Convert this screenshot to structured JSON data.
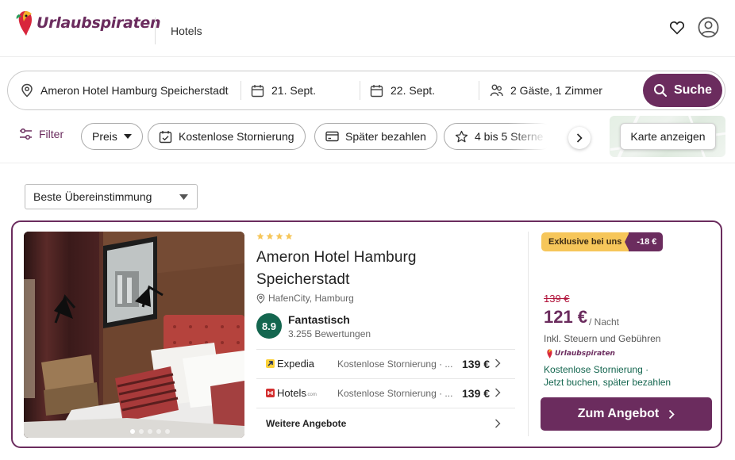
{
  "header": {
    "brand": "Urlaubspiraten",
    "section": "Hotels"
  },
  "search": {
    "destination": "Ameron Hotel Hamburg Speicherstadt",
    "checkin": "21. Sept.",
    "checkout": "22. Sept.",
    "guests": "2 Gäste, 1 Zimmer",
    "button_label": "Suche"
  },
  "filters": {
    "filter_label": "Filter",
    "chips": [
      "Preis",
      "Kostenlose Stornierung",
      "Später bezahlen",
      "4 bis 5 Sterne"
    ],
    "map_button": "Karte anzeigen"
  },
  "sort": {
    "selected": "Beste Übereinstimmung"
  },
  "hotel": {
    "stars": 4,
    "name": "Ameron Hotel Hamburg Speicherstadt",
    "location": "HafenCity, Hamburg",
    "rating": "8.9",
    "rating_label": "Fantastisch",
    "review_count": "3.255 Bewertungen",
    "photo_count": 5,
    "photo_active": 1,
    "offers": [
      {
        "provider": "Expedia",
        "note": "Kostenlose Stornierung · ...",
        "price": "139 €"
      },
      {
        "provider": "Hotels",
        "note": "Kostenlose Stornierung · ...",
        "price": "139 €"
      }
    ],
    "more_offers": "Weitere Angebote",
    "badge_exclusive": "Exklusive bei uns",
    "badge_discount": "-18 €",
    "old_price": "139 €",
    "new_price": "121 €",
    "per_night": "/ Nacht",
    "tax_note": "Inkl. Steuern und Gebühren",
    "provider_brand": "Urlaubspiraten",
    "benefit_1": "Kostenlose Stornierung ·",
    "benefit_2": "Jetzt buchen, später bezahlen",
    "cta_label": "Zum Angebot"
  },
  "colors": {
    "brand": "#6b2c5e",
    "rating_green": "#14664f",
    "badge_yellow": "#f6c65a",
    "strike_red": "#b1133a"
  },
  "icons": {
    "logo": "parrot-logo-icon",
    "favorites": "heart-icon",
    "account": "user-circle-icon",
    "destination": "map-pin-icon",
    "date": "calendar-icon",
    "guests": "people-icon",
    "search": "search-icon",
    "filter": "sliders-icon",
    "chip_cancel": "calendar-check-icon",
    "chip_pay_later": "credit-card-icon",
    "chip_stars": "star-icon",
    "scroll": "chevron-right-icon"
  }
}
